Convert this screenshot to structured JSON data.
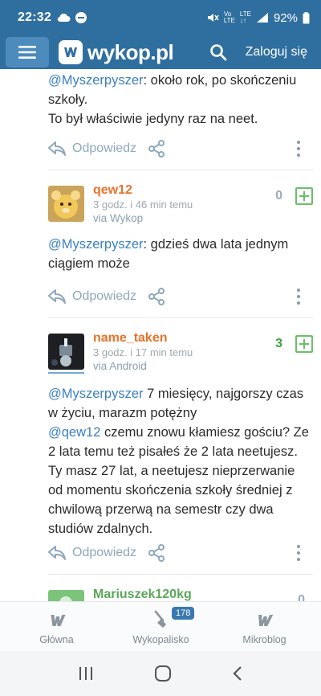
{
  "status": {
    "time": "22:32",
    "battery": "92%"
  },
  "app": {
    "logo_text": "wykop.pl",
    "login_label": "Zaloguj się"
  },
  "comments": [
    {
      "text_lines": [
        {
          "mention": "@Myszerpyszer",
          "rest": ": około rok, po skończeniu"
        },
        {
          "mention": "",
          "rest": "szkoły."
        },
        {
          "mention": "",
          "rest": "To był właściwie jedyny raz na neet."
        }
      ],
      "reply_label": "Odpowiedz"
    },
    {
      "author": "qew12",
      "time": "3 godz. i 46 min temu",
      "via": "via Wykop",
      "votes": "0",
      "text_lines": [
        {
          "mention": "@Myszerpyszer",
          "rest": ": gdzieś dwa lata jednym"
        },
        {
          "mention": "",
          "rest": "ciągiem może"
        }
      ],
      "reply_label": "Odpowiedz"
    },
    {
      "author": "name_taken",
      "time": "3 godz. i 17 min temu",
      "via": "via Android",
      "votes": "3",
      "text_lines": [
        {
          "mention": "@Myszerpyszer",
          "rest": " 7 miesięcy, najgorszy czas"
        },
        {
          "mention": "",
          "rest": "w życiu, marazm potężny"
        },
        {
          "mention": "@qew12",
          "rest": " czemu znowu kłamiesz gościu? Ze"
        },
        {
          "mention": "",
          "rest": "2 lata temu też pisałeś że 2 lata neetujesz."
        },
        {
          "mention": "",
          "rest": "Ty masz 27 lat, a neetujesz nieprzerwanie"
        },
        {
          "mention": "",
          "rest": "od momentu skończenia szkoły średniej z"
        },
        {
          "mention": "",
          "rest": "chwilową przerwą na semestr czy dwa"
        },
        {
          "mention": "",
          "rest": "studiów zdalnych."
        }
      ],
      "reply_label": "Odpowiedz"
    },
    {
      "author": "Mariuszek120kg",
      "votes": "0"
    }
  ],
  "bottom_nav": {
    "items": [
      {
        "label": "Główna",
        "icon": "wykop-logo-icon"
      },
      {
        "label": "Wykopalisko",
        "icon": "shovel-icon",
        "badge": "178"
      },
      {
        "label": "Mikroblog",
        "icon": "microblog-icon"
      }
    ]
  },
  "colors": {
    "header": "#2f6fa0",
    "mention": "#3b7fc2",
    "author_orange": "#e8732a",
    "author_green": "#5aa75a",
    "plus_green": "#6cbf6c"
  }
}
